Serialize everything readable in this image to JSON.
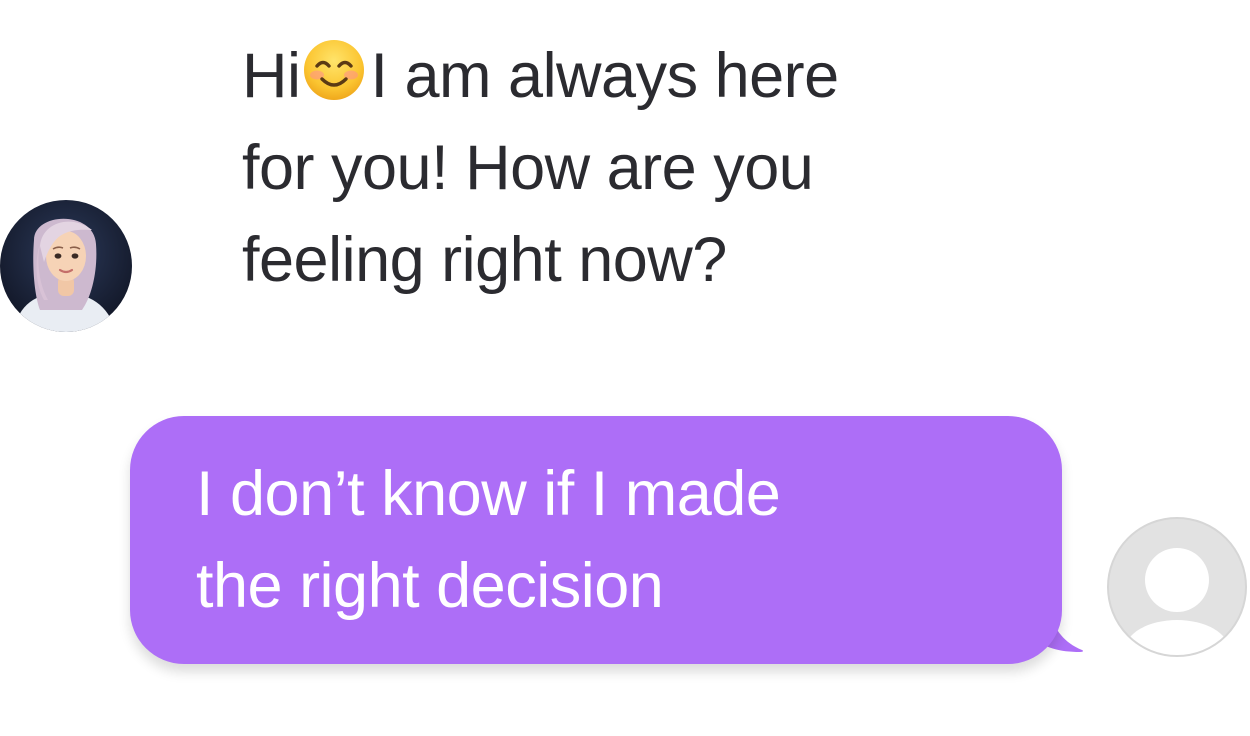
{
  "chat": {
    "bot": {
      "message_lines": [
        "Hi",
        "I am always here",
        "for you! How are you",
        "feeling right now?"
      ],
      "emoji": "smiling-face-with-smiling-eyes-icon"
    },
    "user": {
      "message_lines": [
        "I don’t know if I made",
        "the right decision"
      ]
    }
  },
  "colors": {
    "user_bubble": "#ad6ef7",
    "bot_text": "#2b2b30",
    "user_text": "#ffffff",
    "placeholder_avatar_bg": "#e2e2e2"
  }
}
